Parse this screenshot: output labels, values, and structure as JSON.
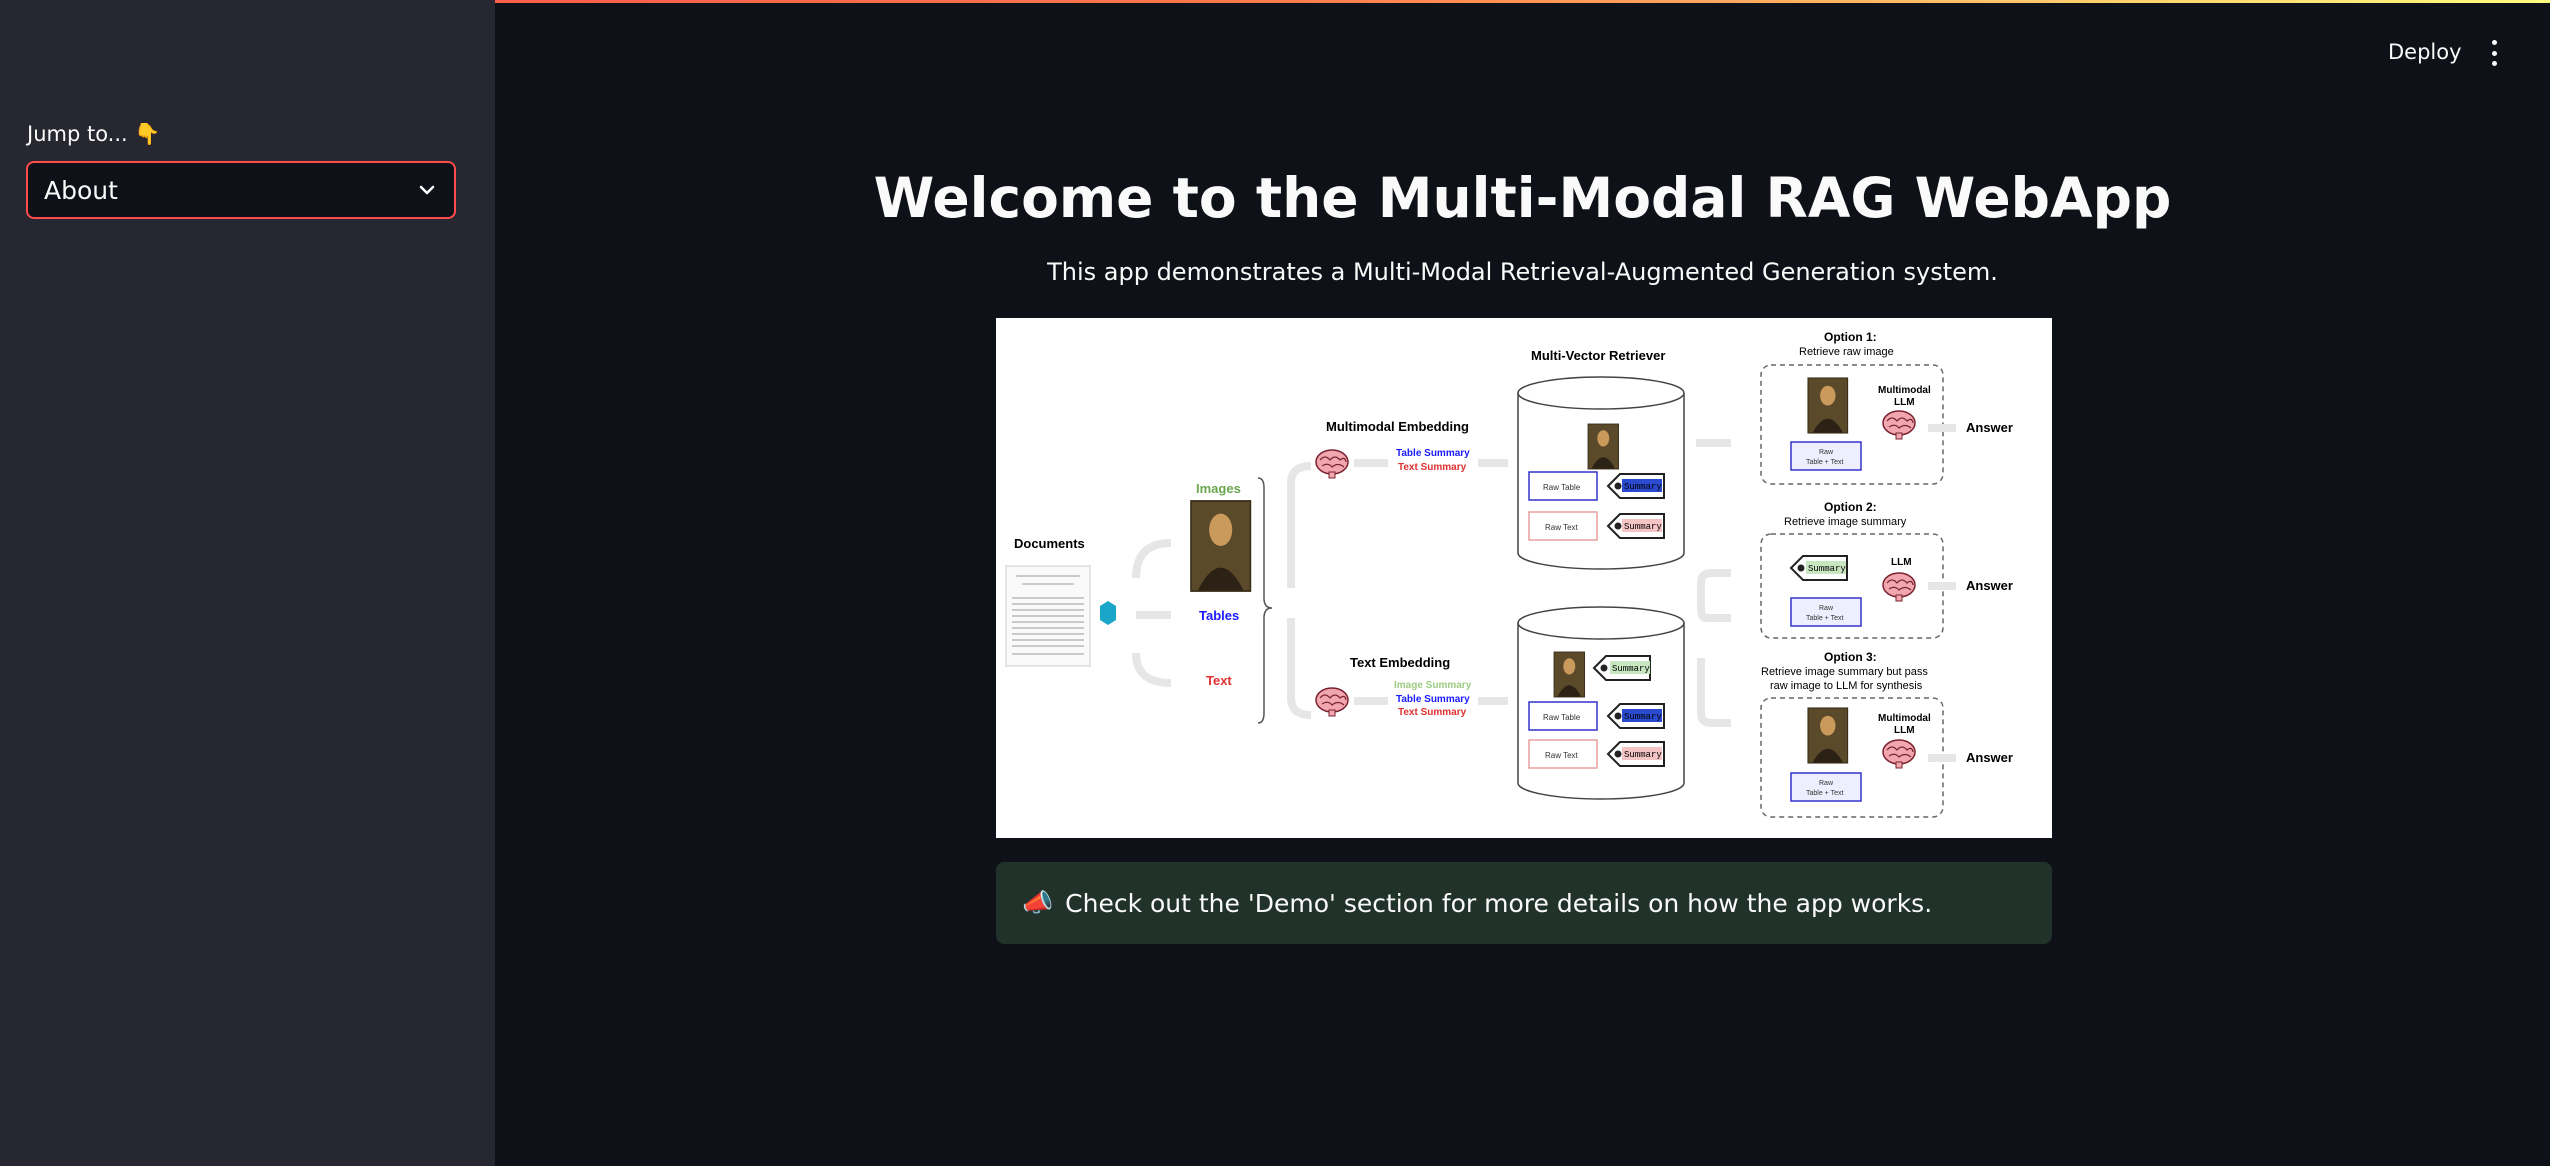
{
  "sidebar": {
    "jump_label": "Jump to...",
    "jump_emoji": "👇",
    "select_value": "About"
  },
  "header": {
    "deploy_label": "Deploy"
  },
  "main": {
    "title": "Welcome to the Multi-Modal RAG WebApp",
    "subtitle": "This app demonstrates a Multi-Modal Retrieval-Augmented Generation system.",
    "info_icon": "📣",
    "info_text": "Check out the 'Demo' section for more details on how the app works."
  },
  "diagram": {
    "documents": "Documents",
    "images": "Images",
    "tables": "Tables",
    "text": "Text",
    "multimodal_embedding": "Multimodal Embedding",
    "text_embedding": "Text Embedding",
    "table_summary": "Table Summary",
    "text_summary": "Text Summary",
    "image_summary": "Image Summary",
    "multi_vector_retriever": "Multi-Vector Retriever",
    "raw_table": "Raw Table",
    "raw_text": "Raw Text",
    "summary": "Summary",
    "option1_title": "Option 1:",
    "option1_desc": "Retrieve raw image",
    "option2_title": "Option 2:",
    "option2_desc": "Retrieve image summary",
    "option3_title": "Option 3:",
    "option3_desc_1": "Retrieve image summary but pass",
    "option3_desc_2": "raw image to LLM for synthesis",
    "multimodal": "Multimodal",
    "llm": "LLM",
    "raw": "Raw",
    "table_text": "Table + Text",
    "answer": "Answer"
  },
  "colors": {
    "accent": "#ff4b4b",
    "background": "#0e1117",
    "sidebar": "#262730",
    "info_bg": "#21322a",
    "images_green": "#6aa84f",
    "tables_blue": "#1a1aff",
    "text_red": "#e03030"
  }
}
